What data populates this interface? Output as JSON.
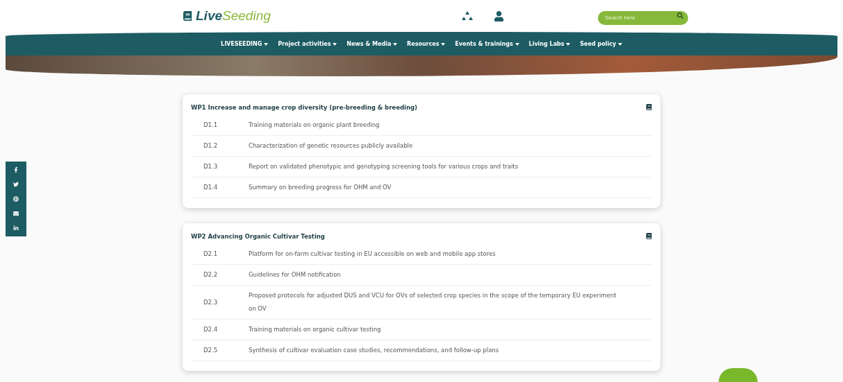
{
  "logo": {
    "text_a": "Live",
    "text_b": "Seeding"
  },
  "search": {
    "placeholder": "Search here"
  },
  "nav": [
    {
      "label": "LIVESEEDING"
    },
    {
      "label": "Project activities"
    },
    {
      "label": "News & Media"
    },
    {
      "label": "Resources"
    },
    {
      "label": "Events & trainings"
    },
    {
      "label": "Living Labs"
    },
    {
      "label": "Seed policy"
    }
  ],
  "work_packages": [
    {
      "title": "WP1 Increase and manage crop diversity (pre-breeding & breeding)",
      "deliverables": [
        {
          "code": "D1.1",
          "title": "Training materials on organic plant breeding"
        },
        {
          "code": "D1.2",
          "title": "Characterization of genetic resources publicly available"
        },
        {
          "code": "D1.3",
          "title": "Report on validated phenotypic and genotyping screening tools for various crops and traits"
        },
        {
          "code": "D1.4",
          "title": "Summary on breeding progress for OHM and OV"
        }
      ]
    },
    {
      "title": "WP2 Advancing Organic Cultivar Testing",
      "deliverables": [
        {
          "code": "D2.1",
          "title": "Platform for on-farm cultivar testing in EU accessible on web and mobile app stores"
        },
        {
          "code": "D2.2",
          "title": "Guidelines for OHM notification"
        },
        {
          "code": "D2.3",
          "title": "Proposed protocols for adjusted DUS and VCU for OVs of selected crop species in the scope of the temporary EU experiment on OV"
        },
        {
          "code": "D2.4",
          "title": "Training materials on organic cultivar testing"
        },
        {
          "code": "D2.5",
          "title": "Synthesis of cultivar evaluation case studies, recommendations, and follow-up plans"
        }
      ]
    }
  ]
}
